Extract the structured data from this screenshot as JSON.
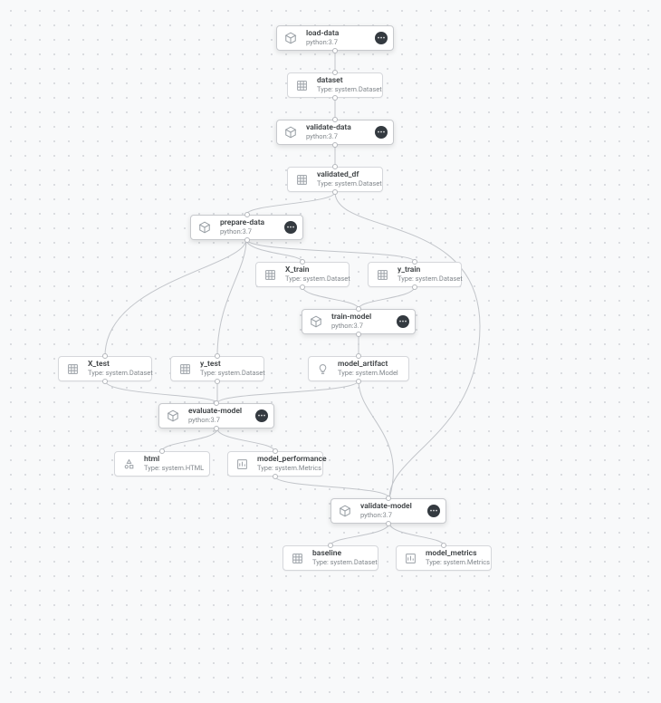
{
  "python": "python:3.7",
  "type_dataset": "Type: system.Dataset",
  "type_model": "Type: system.Model",
  "type_html": "Type: system.HTML",
  "type_metrics": "Type: system.Metrics",
  "nodes": {
    "load_data": {
      "title": "load-data"
    },
    "dataset": {
      "title": "dataset"
    },
    "validate_data": {
      "title": "validate-data"
    },
    "validated_df": {
      "title": "validated_df"
    },
    "prepare_data": {
      "title": "prepare-data"
    },
    "X_train": {
      "title": "X_train"
    },
    "y_train": {
      "title": "y_train"
    },
    "train_model": {
      "title": "train-model"
    },
    "X_test": {
      "title": "X_test"
    },
    "y_test": {
      "title": "y_test"
    },
    "model_artifact": {
      "title": "model_artifact"
    },
    "evaluate_model": {
      "title": "evaluate-model"
    },
    "html": {
      "title": "html"
    },
    "model_performance": {
      "title": "model_performance"
    },
    "validate_model": {
      "title": "validate-model"
    },
    "baseline": {
      "title": "baseline"
    },
    "model_metrics": {
      "title": "model_metrics"
    }
  },
  "status_glyph": "⋯"
}
